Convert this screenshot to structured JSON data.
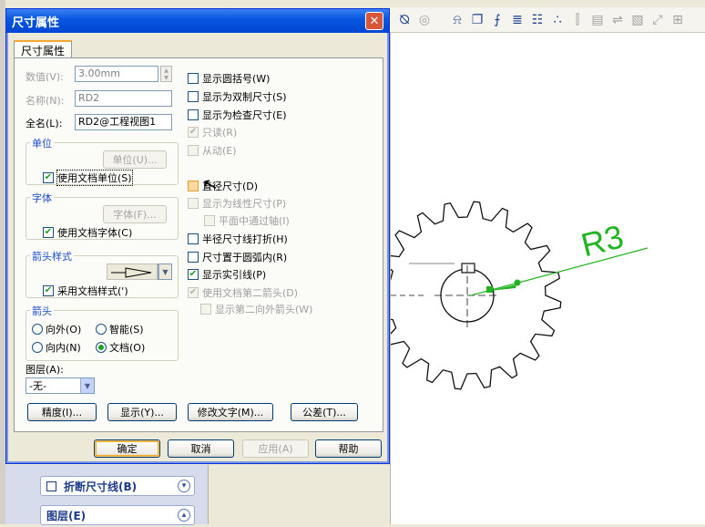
{
  "dialog": {
    "title": "尺寸属性",
    "tab": "尺寸属性",
    "value_label": "数值(V):",
    "value": "3.00mm",
    "name_label": "名称(N):",
    "name": "RD2",
    "fullname_label": "全名(L):",
    "fullname": "RD2@工程视图1",
    "units_group": "单位",
    "units_button": "单位(U)...",
    "use_doc_units": "使用文档单位(S)",
    "font_group": "字体",
    "font_button": "字体(F)...",
    "use_doc_font": "使用文档字体(C)",
    "arrow_style_group": "箭头样式",
    "use_doc_style": "采用文档样式(')",
    "arrows_group": "箭头",
    "radio_outside": "向外(O)",
    "radio_smart": "智能(S)",
    "radio_inside": "向内(N)",
    "radio_document": "文档(O)",
    "layer_label": "图层(A):",
    "layer_value": "-无-",
    "checks": {
      "show_parens": "显示圆括号(W)",
      "show_dual": "显示为双制尺寸(S)",
      "show_inspection": "显示为检查尺寸(E)",
      "read_only": "只读(R)",
      "driven": "从动(E)",
      "diameter": "直径尺寸(D)",
      "show_linear": "显示为线性尺寸(P)",
      "planar_axis": "平面中通过轴(I)",
      "radius_jog": "半径尺寸线打折(H)",
      "dim_inside_arc": "尺寸置于圆弧内(R)",
      "show_leader": "显示实引线(P)",
      "use_doc_second_arrow": "使用文档第二箭头(D)",
      "show_second_outside": "显示第二向外箭头(W)"
    },
    "buttons": {
      "precision": "精度(I)...",
      "display": "显示(Y)...",
      "modify_text": "修改文字(M)...",
      "tolerance": "公差(T)...",
      "ok": "确定",
      "cancel": "取消",
      "apply": "应用(A)",
      "help": "帮助"
    }
  },
  "side_panel": {
    "break_lines": "折断尺寸线(B)",
    "layer": "图层(E)"
  },
  "drawing": {
    "dimension_label": "R3",
    "accent_color": "#22b422"
  }
}
